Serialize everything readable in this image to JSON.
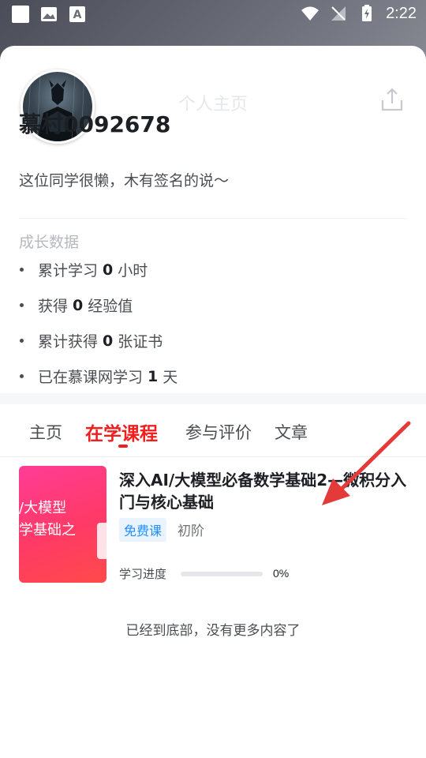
{
  "status_bar": {
    "time": "2:22",
    "icons": [
      "square-icon",
      "image-icon",
      "font-accessibility-icon",
      "wifi-icon",
      "no-signal-icon",
      "battery-charging-icon"
    ]
  },
  "header": {
    "title": "个人主页",
    "back_icon": "chevron-left-icon",
    "share_icon": "share-icon"
  },
  "profile": {
    "username": "慕村0092678",
    "signature": "这位同学很懒，木有签名的说～"
  },
  "growth": {
    "title": "成长数据",
    "items": [
      {
        "prefix": "累计学习",
        "value": "0",
        "suffix": "小时"
      },
      {
        "prefix": "获得",
        "value": "0",
        "suffix": "经验值"
      },
      {
        "prefix": "累计获得",
        "value": "0",
        "suffix": "张证书"
      },
      {
        "prefix": "已在慕课网学习",
        "value": "1",
        "suffix": "天"
      }
    ]
  },
  "tabs": [
    {
      "label": "主页",
      "active": false
    },
    {
      "label": "在学课程",
      "active": true
    },
    {
      "label": "参与评价",
      "active": false
    },
    {
      "label": "文章",
      "active": false
    }
  ],
  "course": {
    "thumbnail_text_line1": "/大模型",
    "thumbnail_text_line2": "学基础之",
    "title": "深入AI/大模型必备数学基础2—微积分入门与核心基础",
    "badge": "免费课",
    "level": "初阶",
    "progress_label": "学习进度",
    "progress_fraction": 0,
    "progress_text": "0%"
  },
  "footer_note": "已经到底部，没有更多内容了",
  "colors": {
    "accent": "#ef1f1f",
    "badge_text": "#1e8fff",
    "badge_bg": "#e9f4ff"
  }
}
